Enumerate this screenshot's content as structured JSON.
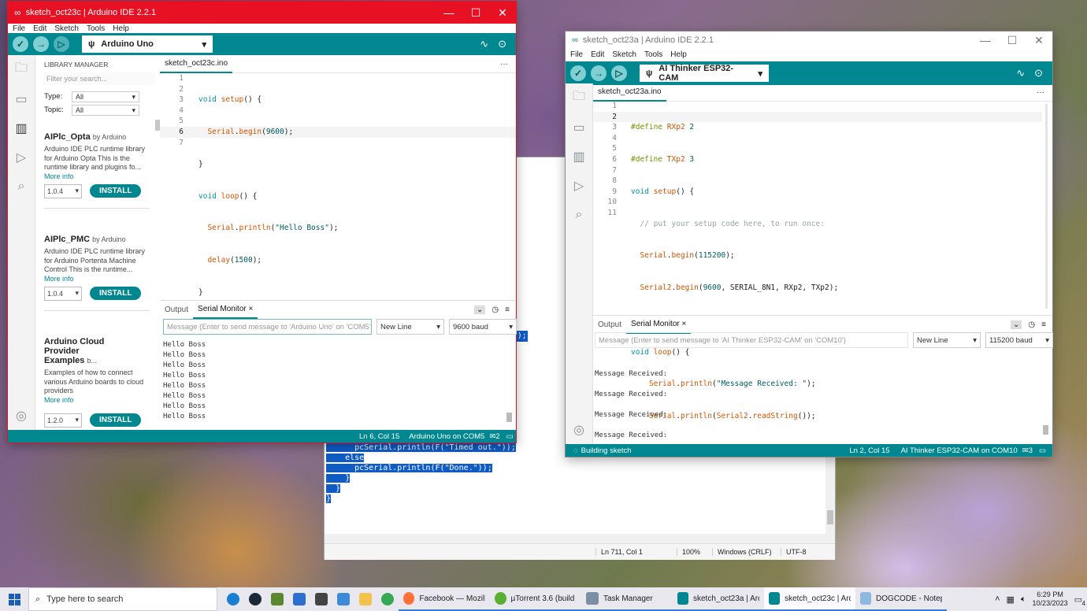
{
  "notepad": {
    "code_lines": [
      "      pcSerial.println(F(\"Timed out.\"));",
      "    else",
      "      pcSerial.println(F(\"Done.\"));",
      "    }",
      "  }",
      "}"
    ],
    "sel_tail": ");",
    "status": {
      "position": "Ln 711, Col 1",
      "zoom": "100%",
      "eol": "Windows (CRLF)",
      "encoding": "UTF-8"
    }
  },
  "win1": {
    "title": "sketch_oct23c | Arduino IDE 2.2.1",
    "menu": [
      "File",
      "Edit",
      "Sketch",
      "Tools",
      "Help"
    ],
    "board": "Arduino Uno",
    "tab": "sketch_oct23c.ino",
    "library": {
      "header": "LIBRARY MANAGER",
      "search_placeholder": "Filter your search...",
      "type_label": "Type:",
      "type_value": "All",
      "topic_label": "Topic:",
      "topic_value": "All",
      "items": [
        {
          "name": "AIPlc_Opta",
          "by": "by Arduino",
          "desc": "Arduino IDE PLC runtime library for Arduino Opta This is the runtime library and plugins fo...",
          "more": "More info",
          "version": "1.0.4",
          "install": "INSTALL"
        },
        {
          "name": "AIPlc_PMC",
          "by": "by Arduino",
          "desc": "Arduino IDE PLC runtime library for Arduino Portenta Machine Control This is the runtime...",
          "more": "More info",
          "version": "1.0.4",
          "install": "INSTALL"
        },
        {
          "name": "Arduino Cloud Provider Examples",
          "by": "b...",
          "desc": "Examples of how to connect various Arduino boards to cloud providers",
          "more": "More info",
          "version": "1.2.0",
          "install": "INSTALL"
        }
      ]
    },
    "code": [
      "void setup() {",
      "  Serial.begin(9600);",
      "}",
      "void loop() {",
      "  Serial.println(\"Hello Boss\");",
      "  delay(1500);",
      "}"
    ],
    "panel": {
      "output_tab": "Output",
      "serial_tab": "Serial Monitor",
      "message_placeholder": "Message (Enter to send message to 'Arduino Uno' on 'COM5')",
      "line_ending": "New Line",
      "baud": "9600 baud",
      "lines": [
        "Hello Boss",
        "Hello Boss",
        "Hello Boss",
        "Hello Boss",
        "Hello Boss",
        "Hello Boss",
        "Hello Boss",
        "Hello Boss"
      ]
    },
    "status": {
      "position": "Ln 6, Col 15",
      "board": "Arduino Uno on COM5",
      "notifications": "2"
    }
  },
  "win2": {
    "title": "sketch_oct23a | Arduino IDE 2.2.1",
    "menu": [
      "File",
      "Edit",
      "Sketch",
      "Tools",
      "Help"
    ],
    "board": "AI Thinker ESP32-CAM",
    "tab": "sketch_oct23a.ino",
    "code": [
      "#define RXp2 2",
      "#define TXp2 3",
      "void setup() {",
      "  // put your setup code here, to run once:",
      "  Serial.begin(115200);",
      "  Serial2.begin(9600, SERIAL_8N1, RXp2, TXp2);",
      "}",
      "void loop() {",
      "    Serial.println(\"Message Received: \");",
      "    Serial.println(Serial2.readString());",
      "}"
    ],
    "panel": {
      "output_tab": "Output",
      "serial_tab": "Serial Monitor",
      "message_placeholder": "Message (Enter to send message to 'AI Thinker ESP32-CAM' on 'COM10')",
      "line_ending": "New Line",
      "baud": "115200 baud",
      "lines": [
        "Message Received:",
        "Message Received:",
        "Message Received:",
        "Message Received:"
      ]
    },
    "status": {
      "building": "Building sketch",
      "position": "Ln 2, Col 15",
      "board": "AI Thinker ESP32-CAM on COM10",
      "notifications": "3"
    }
  },
  "taskbar": {
    "search_placeholder": "Type here to search",
    "apps": [
      "Facebook — Mozill...",
      "µTorrent 3.6  (build ...",
      "Task Manager",
      "sketch_oct23a | Ard...",
      "sketch_oct23c | Ard...",
      "DOGCODE - Notep..."
    ],
    "time": "6:29 PM",
    "date": "10/23/2023",
    "notifications": "4"
  }
}
